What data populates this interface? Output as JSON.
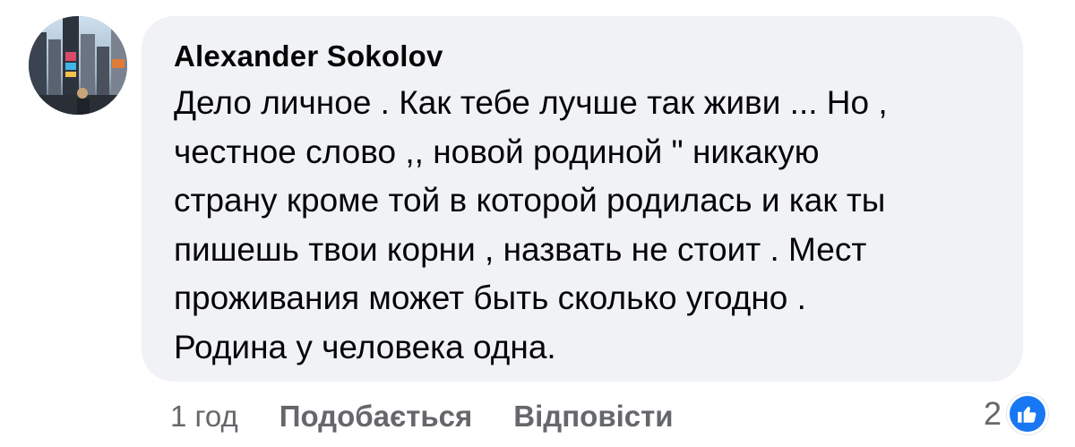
{
  "comment": {
    "author": "Alexander Sokolov",
    "lines": [
      "Дело личное . Как тебе лучше так живи ... Но ,",
      "честное слово ,, новой родиной \" никакую",
      "страну кроме той в которой родилась и как ты",
      "пишешь твои корни , назвать не стоит . Мест",
      "проживания может быть сколько угодно .",
      "Родина у человека одна."
    ]
  },
  "actions": {
    "time": "1 год",
    "like_label": "Подобається",
    "reply_label": "Відповісти"
  },
  "reactions": {
    "count": "2",
    "icon": "thumbs-up-icon"
  },
  "colors": {
    "bubble": "#f0f2f5",
    "text": "#050505",
    "secondary": "#65676b",
    "like_blue": "#1877f2"
  }
}
